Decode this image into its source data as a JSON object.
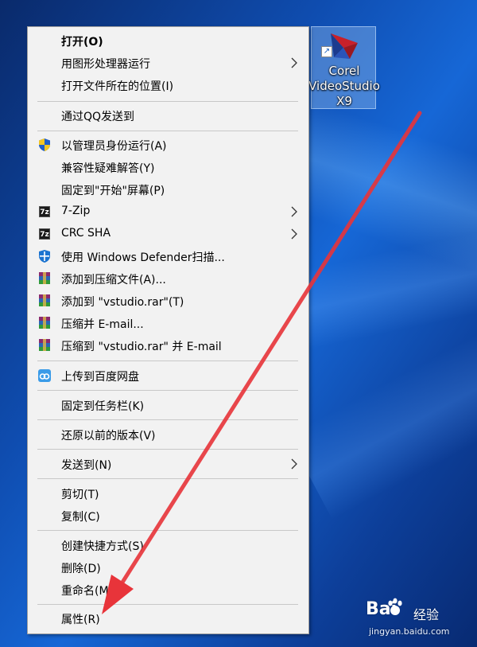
{
  "desktop": {
    "shortcut_label_line1": "Corel",
    "shortcut_label_line2": "VideoStudio",
    "shortcut_label_line3": "X9"
  },
  "context_menu": {
    "items": [
      {
        "label": "打开(O)",
        "bold": true
      },
      {
        "label": "用图形处理器运行",
        "submenu": true
      },
      {
        "label": "打开文件所在的位置(I)"
      },
      {
        "label": "通过QQ发送到"
      },
      {
        "label": "以管理员身份运行(A)",
        "icon": "uac-shield-icon"
      },
      {
        "label": "兼容性疑难解答(Y)"
      },
      {
        "label": "固定到\"开始\"屏幕(P)"
      },
      {
        "label": "7-Zip",
        "icon": "7zip-icon",
        "submenu": true
      },
      {
        "label": "CRC SHA",
        "icon": "7zip-icon",
        "submenu": true
      },
      {
        "label": "使用 Windows Defender扫描...",
        "icon": "defender-shield-icon"
      },
      {
        "label": "添加到压缩文件(A)...",
        "icon": "winrar-icon"
      },
      {
        "label": "添加到 \"vstudio.rar\"(T)",
        "icon": "winrar-icon"
      },
      {
        "label": "压缩并 E-mail...",
        "icon": "winrar-icon"
      },
      {
        "label": "压缩到 \"vstudio.rar\" 并 E-mail",
        "icon": "winrar-icon"
      },
      {
        "label": "上传到百度网盘",
        "icon": "baidu-netdisk-icon"
      },
      {
        "label": "固定到任务栏(K)"
      },
      {
        "label": "还原以前的版本(V)"
      },
      {
        "label": "发送到(N)",
        "submenu": true
      },
      {
        "label": "剪切(T)"
      },
      {
        "label": "复制(C)"
      },
      {
        "label": "创建快捷方式(S)"
      },
      {
        "label": "删除(D)"
      },
      {
        "label": "重命名(M)"
      },
      {
        "label": "属性(R)"
      }
    ],
    "icon_text_7zip": "7z"
  },
  "watermark": {
    "brand": "Bai",
    "brand_suffix": "经验",
    "url": "jingyan.baidu.com"
  },
  "colors": {
    "annotation_arrow": "#e8343a",
    "menu_background": "#f2f2f2"
  }
}
